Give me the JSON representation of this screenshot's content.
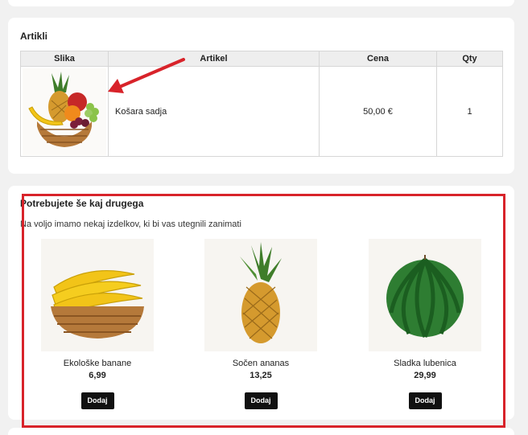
{
  "artikli": {
    "title": "Artikli",
    "columns": [
      "Slika",
      "Artikel",
      "Cena",
      "Qty"
    ],
    "rows": [
      {
        "image": "fruit-basket-image",
        "name": "Košara sadja",
        "price": "50,00 €",
        "qty": "1"
      }
    ]
  },
  "upsell": {
    "title": "Potrebujete še kaj drugega",
    "subtitle": "Na voljo imamo nekaj izdelkov, ki bi vas utegnili zanimati",
    "products": [
      {
        "image": "banana-basket-image",
        "name": "Ekološke banane",
        "price": "6,99",
        "button": "Dodaj"
      },
      {
        "image": "pineapple-image",
        "name": "Sočen ananas",
        "price": "13,25",
        "button": "Dodaj"
      },
      {
        "image": "watermelon-image",
        "name": "Sladka lubenica",
        "price": "29,99",
        "button": "Dodaj"
      }
    ]
  },
  "colors": {
    "annotation": "#d8232a",
    "button": "#111111",
    "header_bg": "#eeeeee"
  }
}
